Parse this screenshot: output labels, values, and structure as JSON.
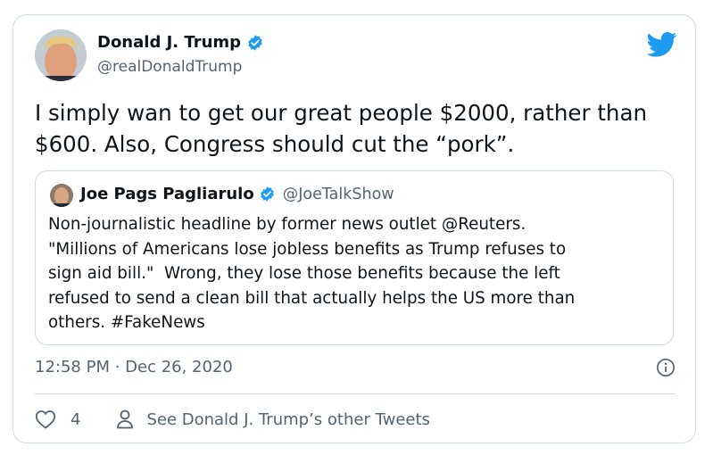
{
  "author": {
    "name": "Donald J. Trump",
    "handle": "@realDonaldTrump",
    "verified": true
  },
  "tweet": {
    "text": "I simply wan to get our great people $2000, rather than $600. Also, Congress should cut the “pork”.",
    "timestamp": "12:58 PM · Dec 26, 2020"
  },
  "quoted": {
    "name": "Joe Pags Pagliarulo",
    "handle": "@JoeTalkShow",
    "verified": true,
    "text": "Non-journalistic headline by former news outlet @Reuters.\n\"Millions of Americans lose jobless benefits as Trump refuses to\nsign aid bill.\"  Wrong, they lose those benefits because the left\nrefused to send a clean bill that actually helps the US more than\nothers. #FakeNews"
  },
  "actions": {
    "like_count": "4",
    "other_tweets_label": "See Donald J. Trump’s other Tweets"
  },
  "colors": {
    "brand_blue": "#1d9bf0",
    "text_primary": "#0f1419",
    "text_secondary": "#536471",
    "border": "#cfd9de"
  },
  "icons": [
    "verified-badge-icon",
    "twitter-bird-icon",
    "info-icon",
    "heart-icon",
    "person-icon"
  ]
}
